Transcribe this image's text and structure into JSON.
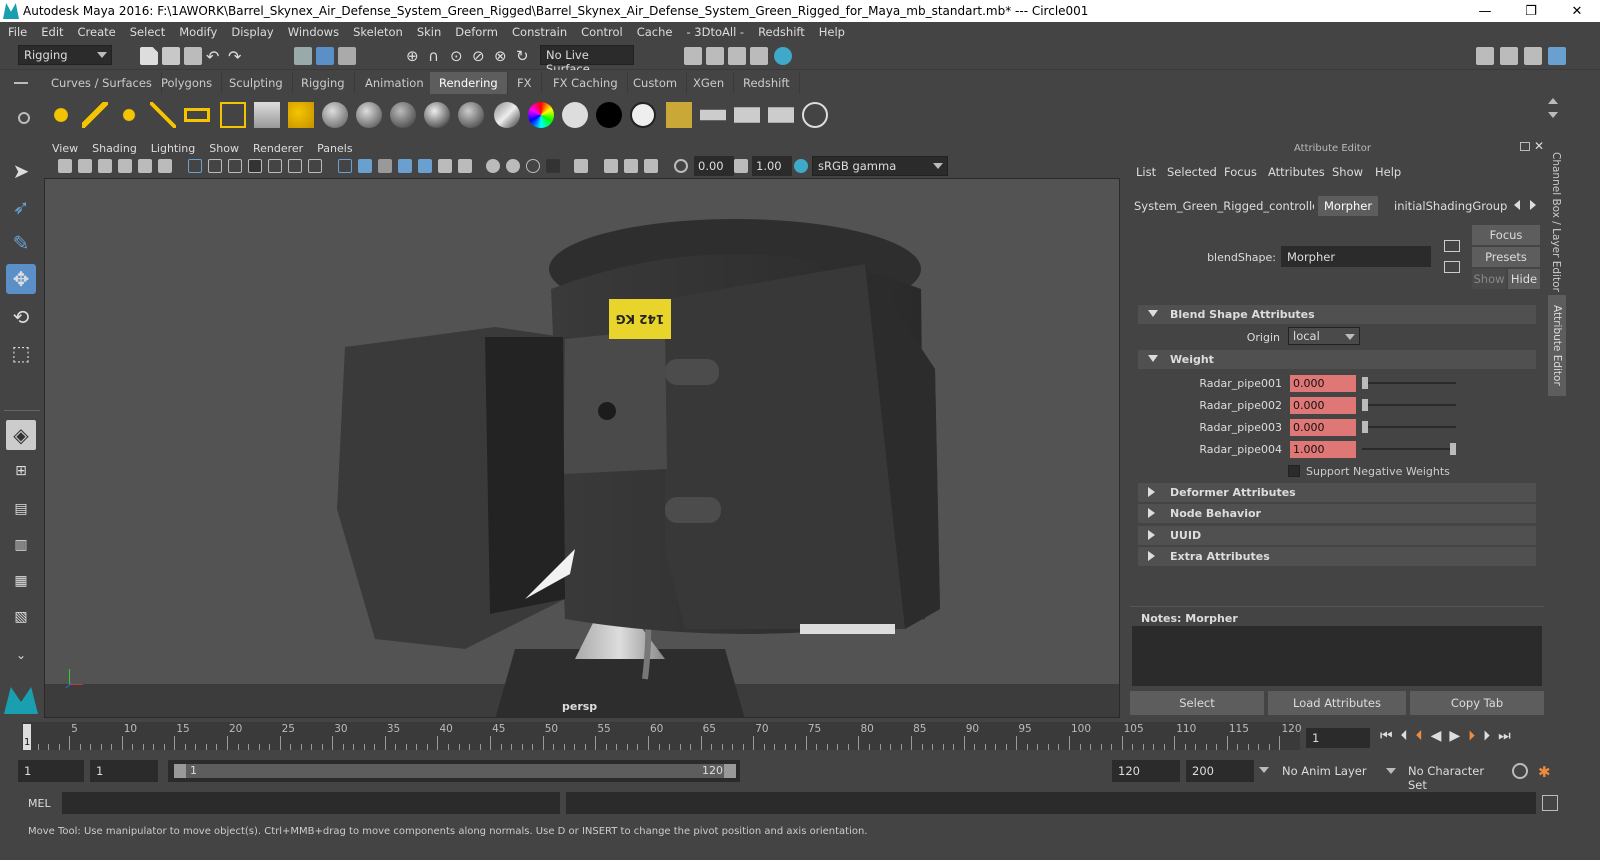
{
  "window": {
    "title": "Autodesk Maya 2016: F:\\1AWORK\\Barrel_Skynex_Air_Defense_System_Green_Rigged\\Barrel_Skynex_Air_Defense_System_Green_Rigged_for_Maya_mb_standart.mb*   ---   Circle001",
    "buttons": {
      "minimize": "—",
      "maximize": "❐",
      "close": "✕"
    }
  },
  "menubar": [
    "File",
    "Edit",
    "Create",
    "Select",
    "Modify",
    "Display",
    "Windows",
    "Skeleton",
    "Skin",
    "Deform",
    "Constrain",
    "Control",
    "Cache",
    "- 3DtoAll -",
    "Redshift",
    "Help"
  ],
  "statusline": {
    "menuset": "Rigging",
    "live_surface": "No Live Surface"
  },
  "shelf_tabs": [
    {
      "label": "Curves / Surfaces"
    },
    {
      "label": "Polygons"
    },
    {
      "label": "Sculpting"
    },
    {
      "label": "Rigging"
    },
    {
      "label": "Animation"
    },
    {
      "label": "Rendering"
    },
    {
      "label": "FX"
    },
    {
      "label": "FX Caching"
    },
    {
      "label": "Custom"
    },
    {
      "label": "XGen"
    },
    {
      "label": "Redshift"
    }
  ],
  "shelf_active_tab": "Rendering",
  "viewport": {
    "menus": [
      "View",
      "Shading",
      "Lighting",
      "Show",
      "Renderer",
      "Panels"
    ],
    "exposure": "0.00",
    "gamma": "1.00",
    "color_space": "sRGB gamma",
    "camera_label": "persp",
    "decal_text": "142 KG"
  },
  "attribute_editor": {
    "title": "Attribute Editor",
    "menus": [
      "List",
      "Selected",
      "Focus",
      "Attributes",
      "Show",
      "Help"
    ],
    "tabs": [
      "System_Green_Rigged_controllers",
      "Morpher",
      "initialShadingGroup"
    ],
    "active_tab": "Morpher",
    "node_type_label": "blendShape:",
    "node_name": "Morpher",
    "side_buttons": {
      "focus": "Focus",
      "presets": "Presets",
      "show": "Show",
      "hide": "Hide"
    },
    "sections": {
      "blend_shape": "Blend Shape Attributes",
      "origin_label": "Origin",
      "origin_value": "local",
      "weight": "Weight",
      "deformer": "Deformer Attributes",
      "node_behavior": "Node Behavior",
      "uuid": "UUID",
      "extra": "Extra Attributes"
    },
    "weights": [
      {
        "name": "Radar_pipe001",
        "value": "0.000",
        "level": 0
      },
      {
        "name": "Radar_pipe002",
        "value": "0.000",
        "level": 0
      },
      {
        "name": "Radar_pipe003",
        "value": "0.000",
        "level": 0
      },
      {
        "name": "Radar_pipe004",
        "value": "1.000",
        "level": 1
      }
    ],
    "support_negative": "Support Negative Weights",
    "notes_label": "Notes:  Morpher",
    "bottom_buttons": {
      "select": "Select",
      "load": "Load Attributes",
      "copy": "Copy Tab"
    }
  },
  "right_dock_tabs": {
    "channel_box": "Channel Box / Layer Editor",
    "attribute_editor": "Attribute Editor"
  },
  "time_slider": {
    "ticks": [
      5,
      10,
      15,
      20,
      25,
      30,
      35,
      40,
      45,
      50,
      55,
      60,
      65,
      70,
      75,
      80,
      85,
      90,
      95,
      100,
      105,
      110,
      115,
      120
    ],
    "current_frame_marker": "1",
    "current_frame": "1"
  },
  "range_slider": {
    "start": "1",
    "playback_start": "1",
    "range_start_label": "1",
    "range_end_label": "120",
    "playback_end": "120",
    "end": "200",
    "anim_layer": "No Anim Layer",
    "character_set": "No Character Set"
  },
  "command_line": {
    "lang": "MEL"
  },
  "help_line": "Move Tool: Use manipulator to move object(s). Ctrl+MMB+drag to move components along normals. Use D or INSERT to change the pivot position and axis orientation.",
  "colors": {
    "weight_field": "#e07777",
    "active_tab": "#5d5d5d",
    "viewport_bg": "#535353",
    "decal": "#e8d42a"
  }
}
